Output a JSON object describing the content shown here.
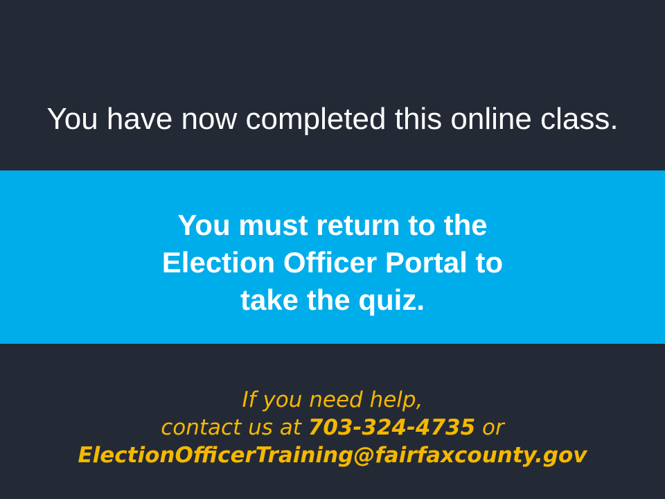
{
  "slide": {
    "headline": "You have now completed this online class.",
    "instruction_lines": [
      "You must return to the",
      "Election Officer Portal to",
      "take the quiz."
    ],
    "help": {
      "line1": "If you need help,",
      "contact_prefix": "contact us at",
      "phone": "703-324-4735",
      "contact_suffix": "or",
      "email": "ElectionOfficerTraining@fairfaxcounty.gov"
    }
  },
  "colors": {
    "background": "#242a35",
    "banner": "#00adeb",
    "primary_text": "#ffffff",
    "accent_text": "#f5b800"
  }
}
